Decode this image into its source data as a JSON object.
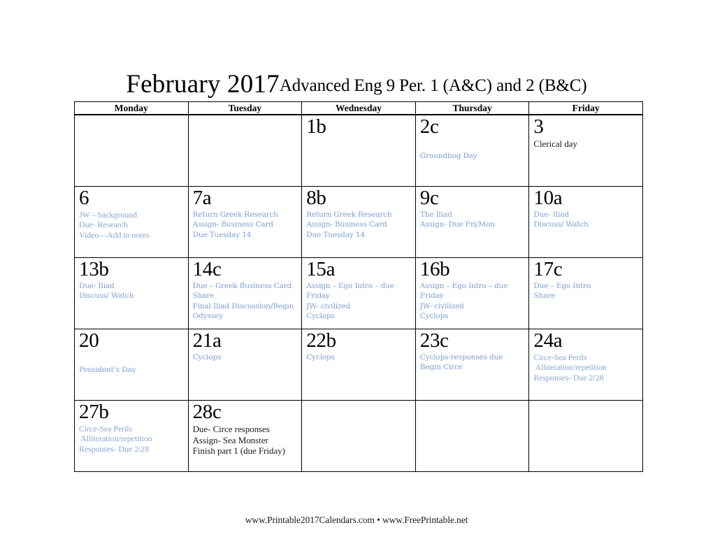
{
  "title": {
    "month_year": "February 2017",
    "subtitle": "Advanced Eng 9 Per. 1 (A&C) and 2 (B&C)"
  },
  "colors": {
    "note_blue": "#7d9fd4",
    "note_blue_alt": "#8aa6d6",
    "note_black": "#1a1a1a",
    "grid_line": "#000000"
  },
  "weekdays": [
    "Monday",
    "Tuesday",
    "Wednesday",
    "Thursday",
    "Friday"
  ],
  "weeks": [
    [
      {
        "daynum": "",
        "notes": [],
        "style": "",
        "offset": ""
      },
      {
        "daynum": "",
        "notes": [],
        "style": "",
        "offset": ""
      },
      {
        "daynum": "1b",
        "notes": [],
        "style": "",
        "offset": ""
      },
      {
        "daynum": "2c",
        "notes": [
          "Groundhog Day"
        ],
        "style": "blue",
        "offset": "offset-lg"
      },
      {
        "daynum": "3",
        "notes": [
          "Clerical day"
        ],
        "style": "black",
        "offset": ""
      }
    ],
    [
      {
        "daynum": "6",
        "notes": [
          "JW – background",
          "Due- Research",
          "Video—Add to notes"
        ],
        "style": "blue-alt",
        "offset": ""
      },
      {
        "daynum": "7a",
        "notes": [
          "Return Greek Research",
          "Assign- Business Card",
          "Due Tuesday 14"
        ],
        "style": "blue",
        "offset": ""
      },
      {
        "daynum": "8b",
        "notes": [
          "Return Greek Research",
          "Assign- Business Card",
          "Due Tuesday 14"
        ],
        "style": "blue",
        "offset": ""
      },
      {
        "daynum": "9c",
        "notes": [
          "The Iliad",
          "Assign- Due Fri/Mon"
        ],
        "style": "blue",
        "offset": ""
      },
      {
        "daynum": "10a",
        "notes": [
          "Due- Iliad",
          "Discuss/ Watch"
        ],
        "style": "blue",
        "offset": ""
      }
    ],
    [
      {
        "daynum": "13b",
        "notes": [
          "Due- Iliad",
          "Discuss/ Watch"
        ],
        "style": "blue",
        "offset": ""
      },
      {
        "daynum": "14c",
        "notes": [
          "Due – Greek Business Card",
          "Share",
          "Final Iliad Discussion/Begin",
          "Odyssey"
        ],
        "style": "blue",
        "offset": ""
      },
      {
        "daynum": "15a",
        "notes": [
          "Assign – Ego Intro – due",
          "Friday",
          "JW- civilized",
          "Cyclops"
        ],
        "style": "blue",
        "offset": ""
      },
      {
        "daynum": "16b",
        "notes": [
          "Assign – Ego Intro – due",
          "Friday",
          "JW- civilized",
          "Cyclops"
        ],
        "style": "blue",
        "offset": ""
      },
      {
        "daynum": "17c",
        "notes": [
          "Due – Ego Intro",
          "Share"
        ],
        "style": "blue",
        "offset": ""
      }
    ],
    [
      {
        "daynum": "20",
        "notes": [
          "President’s Day"
        ],
        "style": "blue",
        "offset": "offset-lg"
      },
      {
        "daynum": "21a",
        "notes": [
          "Cyclops"
        ],
        "style": "blue",
        "offset": ""
      },
      {
        "daynum": "22b",
        "notes": [
          "Cyclops"
        ],
        "style": "blue",
        "offset": ""
      },
      {
        "daynum": "23c",
        "notes": [
          "Cyclops-responses due",
          "Begin Circe"
        ],
        "style": "blue",
        "offset": ""
      },
      {
        "daynum": "24a",
        "notes": [
          "Circe-Sea Perils",
          " Alliteration/repetition",
          "Responses- Due 2/28"
        ],
        "style": "blue-alt",
        "offset": ""
      }
    ],
    [
      {
        "daynum": "27b",
        "notes": [
          "Circe-Sea Perils",
          " Alliteration/repetition",
          "Responses- Due 2/28"
        ],
        "style": "blue-alt",
        "offset": ""
      },
      {
        "daynum": "28c",
        "notes": [
          "Due- Circe responses",
          "Assign- Sea Monster",
          "Finish part 1 (due Friday)"
        ],
        "style": "black",
        "offset": ""
      },
      {
        "daynum": "",
        "notes": [],
        "style": "",
        "offset": ""
      },
      {
        "daynum": "",
        "notes": [],
        "style": "",
        "offset": ""
      },
      {
        "daynum": "",
        "notes": [],
        "style": "",
        "offset": ""
      }
    ]
  ],
  "footer": {
    "text": "www.Printable2017Calendars.com • www.FreePrintable.net"
  }
}
